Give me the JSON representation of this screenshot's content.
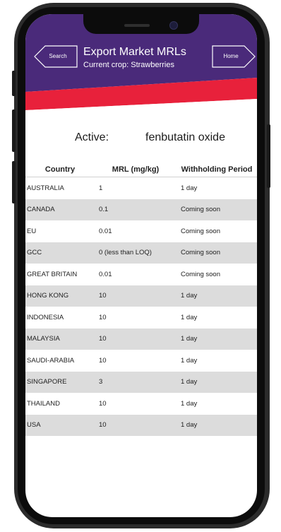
{
  "header": {
    "back_label": "Search",
    "title": "Export Market MRLs",
    "subtitle": "Current crop: Strawberries",
    "home_label": "Home"
  },
  "active": {
    "label": "Active:",
    "value": "fenbutatin oxide"
  },
  "table": {
    "headers": [
      "Country",
      "MRL (mg/kg)",
      "Withholding Period"
    ],
    "rows": [
      [
        "AUSTRALIA",
        "1",
        "1 day"
      ],
      [
        "CANADA",
        "0.1",
        "Coming soon"
      ],
      [
        "EU",
        "0.01",
        "Coming soon"
      ],
      [
        "GCC",
        "0 (less than LOQ)",
        "Coming soon"
      ],
      [
        "GREAT BRITAIN",
        "0.01",
        "Coming soon"
      ],
      [
        "HONG KONG",
        "10",
        "1 day"
      ],
      [
        "INDONESIA",
        "10",
        "1 day"
      ],
      [
        "MALAYSIA",
        "10",
        "1 day"
      ],
      [
        "SAUDI-ARABIA",
        "10",
        "1 day"
      ],
      [
        "SINGAPORE",
        "3",
        "1 day"
      ],
      [
        "THAILAND",
        "10",
        "1 day"
      ],
      [
        "USA",
        "10",
        "1 day"
      ]
    ]
  },
  "colors": {
    "header_purple": "#4a2a7a",
    "accent_red": "#e8213b",
    "row_alt": "#dcdcdc"
  }
}
